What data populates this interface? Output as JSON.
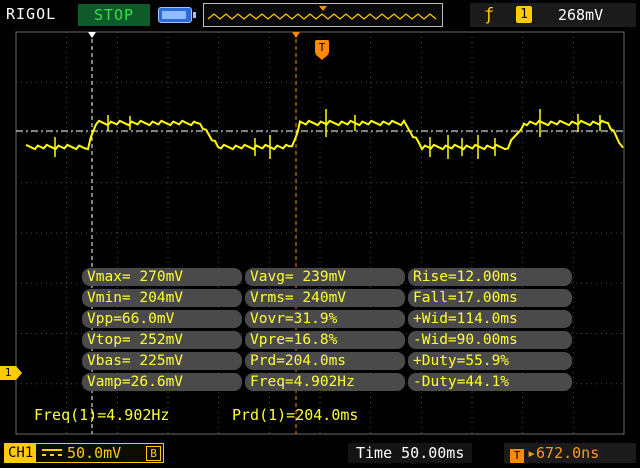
{
  "topbar": {
    "brand": "RIGOL",
    "run_state": "STOP",
    "trigger_edge_icon": "rising-edge-icon",
    "trigger_source": "1",
    "trigger_level": "268mV"
  },
  "trigger_marker_label": "T",
  "channel_marker_label": "1",
  "measurements": [
    [
      "Vmax= 270mV",
      "Vavg= 239mV",
      "Rise=12.00ms"
    ],
    [
      "Vmin= 204mV",
      "Vrms= 240mV",
      "Fall=17.00ms"
    ],
    [
      "Vpp=66.0mV",
      "Vovr=31.9%",
      "+Wid=114.0ms"
    ],
    [
      "Vtop= 252mV",
      "Vpre=16.8%",
      "-Wid=90.00ms"
    ],
    [
      "Vbas= 225mV",
      "Prd=204.0ms",
      "+Duty=55.9%"
    ],
    [
      "Vamp=26.6mV",
      "Freq=4.902Hz",
      "-Duty=44.1%"
    ]
  ],
  "cursor_readout": {
    "freq": "Freq(1)=4.902Hz",
    "prd": "Prd(1)=204.0ms"
  },
  "bottombar": {
    "channel_label": "CH1",
    "coupling_icon": "dc-coupling-icon",
    "vertical_scale": "50.0mV",
    "bw_limit": "B",
    "timebase": "Time 50.00ms",
    "trigger_position_icon": "T",
    "trigger_position": "672.0ns"
  },
  "colors": {
    "trace": "#ffff00",
    "accent": "#ffcc00",
    "trigger": "#ff8a00",
    "run_state": "#35e04a"
  }
}
